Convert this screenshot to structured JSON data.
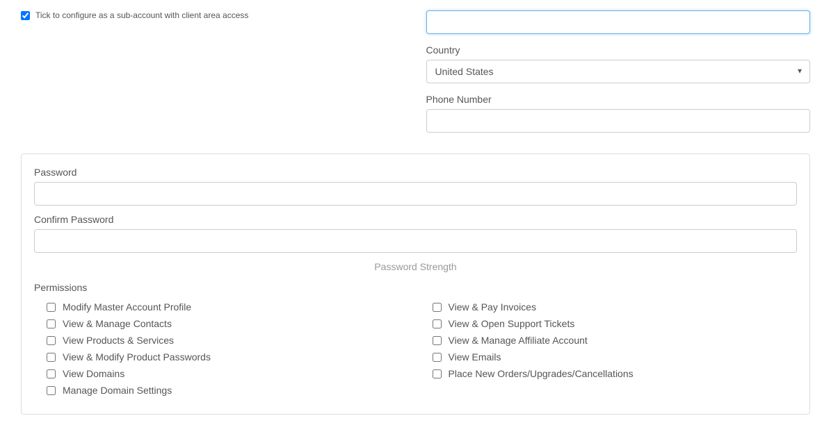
{
  "subaccount": {
    "checkbox_label": "Tick to configure as a sub-account with client area access",
    "checked": true
  },
  "fields": {
    "top_input_value": "",
    "country_label": "Country",
    "country_value": "United States",
    "phone_label": "Phone Number",
    "phone_value": ""
  },
  "password_panel": {
    "password_label": "Password",
    "password_value": "",
    "confirm_label": "Confirm Password",
    "confirm_value": "",
    "strength_label": "Password Strength"
  },
  "permissions": {
    "heading": "Permissions",
    "left": [
      "Modify Master Account Profile",
      "View & Manage Contacts",
      "View Products & Services",
      "View & Modify Product Passwords",
      "View Domains",
      "Manage Domain Settings"
    ],
    "right": [
      "View & Pay Invoices",
      "View & Open Support Tickets",
      "View & Manage Affiliate Account",
      "View Emails",
      "Place New Orders/Upgrades/Cancellations"
    ]
  }
}
